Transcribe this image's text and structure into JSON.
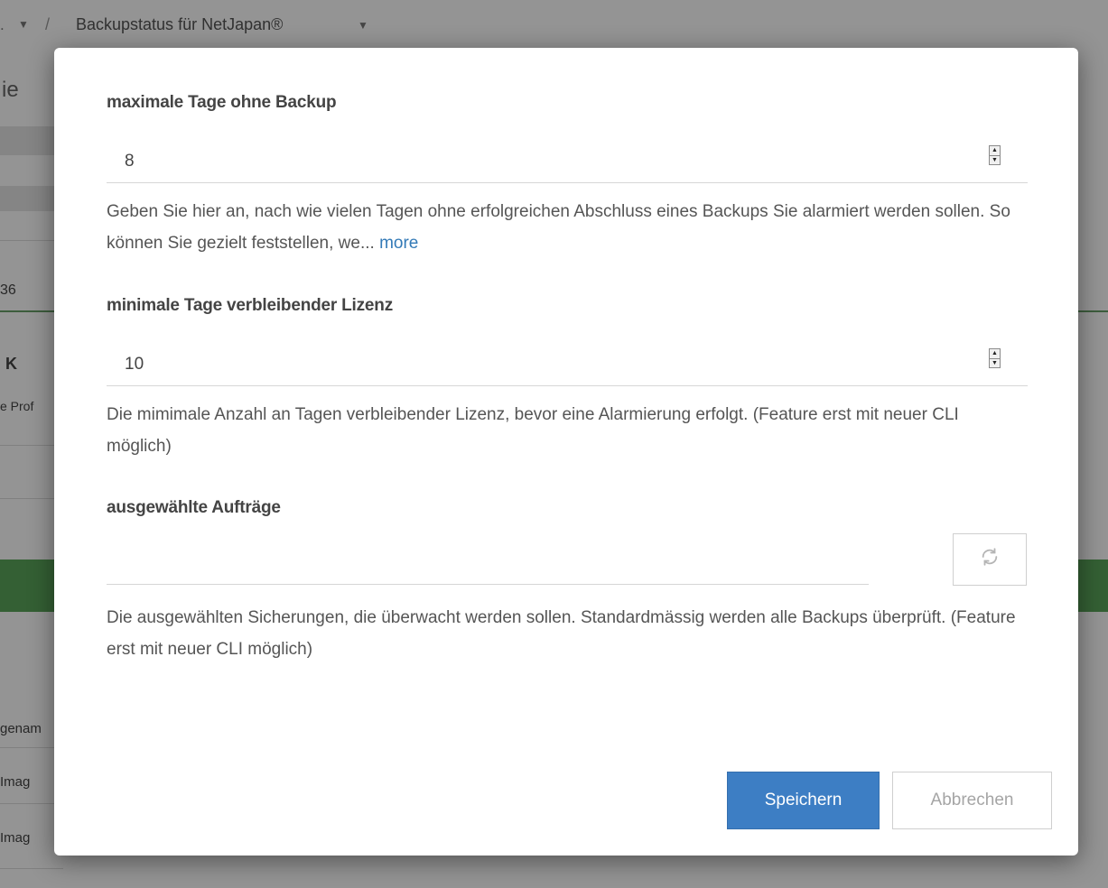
{
  "background": {
    "breadcrumb": {
      "prefix": ".",
      "separator": "/",
      "title": "Backupstatus für NetJapan®"
    },
    "heading_fragment": "ie",
    "text_fragments": {
      "number": "36",
      "status": "K",
      "subtext": "e Prof",
      "column_header": "genam",
      "row_1": "Imag",
      "row_2": "Imag"
    }
  },
  "modal": {
    "max_days": {
      "label": "maximale Tage ohne Backup",
      "value": "8",
      "help_text": "Geben Sie hier an, nach wie vielen Tagen ohne erfolgreichen Abschluss eines Backups Sie alarmiert werden sollen. So können Sie gezielt feststellen, we...",
      "more_link": "more"
    },
    "min_license_days": {
      "label": "minimale Tage verbleibender Lizenz",
      "value": "10",
      "help_text": "Die mimimale Anzahl an Tagen verbleibender Lizenz, bevor eine Alarmierung erfolgt. (Feature erst mit neuer CLI möglich)"
    },
    "selected_jobs": {
      "label": "ausgewählte Aufträge",
      "value": "",
      "help_text": "Die ausgewählten Sicherungen, die überwacht werden sollen. Standardmässig werden alle Backups überprüft. (Feature erst mit neuer CLI möglich)"
    },
    "buttons": {
      "save": "Speichern",
      "cancel": "Abbrechen"
    }
  },
  "icons": {
    "refresh": "refresh-icon",
    "dropdown": "caret-down-icon",
    "spinner_up": "spinner-up-icon",
    "spinner_down": "spinner-down-icon"
  },
  "colors": {
    "primary": "#3d7ec4",
    "link": "#337ab7",
    "success_band": "#5aa55a"
  }
}
